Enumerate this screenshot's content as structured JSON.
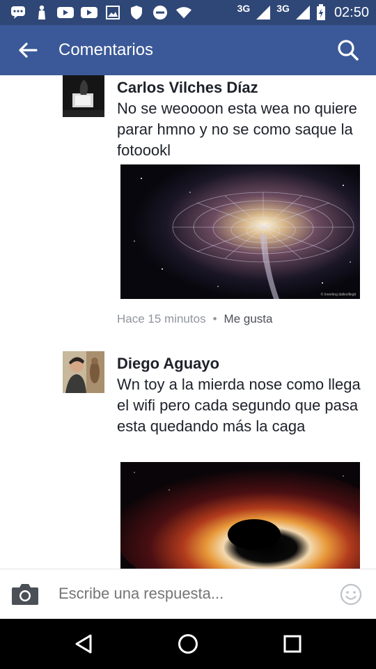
{
  "status_bar": {
    "network_1": "3G",
    "network_2": "3G",
    "time": "02:50",
    "icons": [
      "messages-icon",
      "person-icon",
      "youtube-icon",
      "youtube-icon",
      "gallery-icon",
      "shield-icon",
      "do-not-disturb-icon",
      "wifi-icon",
      "signal-icon",
      "signal-icon",
      "battery-charging-icon"
    ]
  },
  "app_bar": {
    "title": "Comentarios",
    "back_icon": "arrow-left-icon",
    "search_icon": "search-icon",
    "background": "#3b5998"
  },
  "comments": [
    {
      "author": "Carlos Vilches Díaz",
      "text": "No se weoooon esta wea no quiere parar hmno y no se como saque la fotoookl",
      "photo": "galaxy-spiral-image",
      "photo_credit": "© Inverting dallexIllegit",
      "time": "Hace 15 minutos",
      "separator": "•",
      "like_label": "Me gusta"
    },
    {
      "author": "Diego Aguayo",
      "text": "Wn toy a la mierda nose como llega el wifi pero cada segundo que pasa esta quedando más la caga",
      "photo": "black-hole-image"
    }
  ],
  "reply_bar": {
    "placeholder": "Escribe una respuesta...",
    "camera_icon": "camera-icon",
    "emoji_icon": "smiley-icon"
  },
  "nav_bar": {
    "back": "back-triangle-icon",
    "home": "home-circle-icon",
    "recents": "recents-square-icon"
  },
  "colors": {
    "status_bar": "#2f4777",
    "app_bar": "#3b5998",
    "text": "#1d2129",
    "meta": "#90949c"
  }
}
